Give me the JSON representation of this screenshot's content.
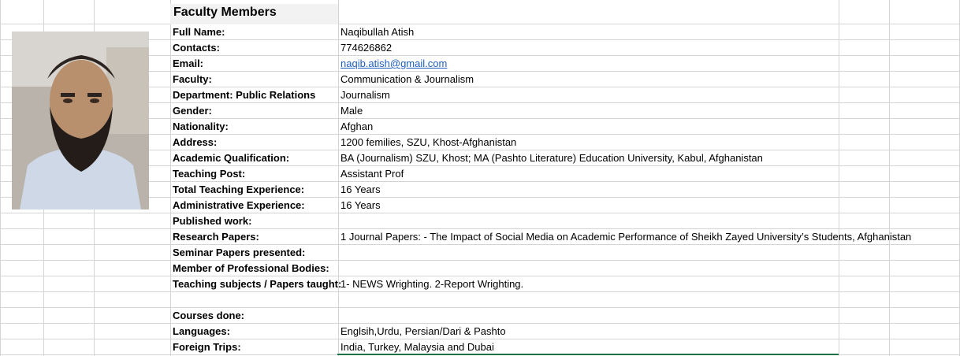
{
  "sheet": {
    "title": "Faculty Members",
    "photo_alt": "profile-photo",
    "rows": [
      {
        "label": "Full Name:",
        "value": "Naqibullah Atish"
      },
      {
        "label": "Contacts:",
        "value": "774626862"
      },
      {
        "label": "Email:",
        "value": "naqib.atish@gmail.com"
      },
      {
        "label": "Faculty:",
        "value": "Communication & Journalism"
      },
      {
        "label": "Department: Public Relations",
        "value": "Journalism"
      },
      {
        "label": "Gender:",
        "value": "Male"
      },
      {
        "label": "Nationality:",
        "value": "Afghan"
      },
      {
        "label": "Address:",
        "value": "1200 femilies, SZU, Khost-Afghanistan"
      },
      {
        "label": "Academic Qualification:",
        "value": "BA (Journalism) SZU, Khost; MA (Pashto Literature) Education University, Kabul, Afghanistan"
      },
      {
        "label": "Teaching Post:",
        "value": " Assistant Prof"
      },
      {
        "label": "Total Teaching Experience:",
        "value": "16 Years"
      },
      {
        "label": "Administrative Experience:",
        "value": "16 Years"
      },
      {
        "label": "Published work:",
        "value": ""
      },
      {
        "label": "Research Papers:",
        "value": "1 Journal Papers: - The Impact of Social Media on Academic Performance of Sheikh Zayed University’s Students, Afghanistan"
      },
      {
        "label": "Seminar Papers presented:",
        "value": ""
      },
      {
        "label": "Member of Professional Bodies:",
        "value": ""
      },
      {
        "label": "Teaching subjects / Papers taught:",
        "value": "1- NEWS Wrighting. 2-Report Wrighting."
      },
      {
        "label": "Courses done:",
        "value": ""
      },
      {
        "label": "Languages:",
        "value": "Englsih,Urdu, Persian/Dari & Pashto"
      },
      {
        "label": "Foreign Trips:",
        "value": "India, Turkey, Malaysia and Dubai"
      }
    ]
  },
  "colors": {
    "link": "#1f5fbf",
    "gridline": "#d4d4d4",
    "selection": "#1e7145"
  }
}
